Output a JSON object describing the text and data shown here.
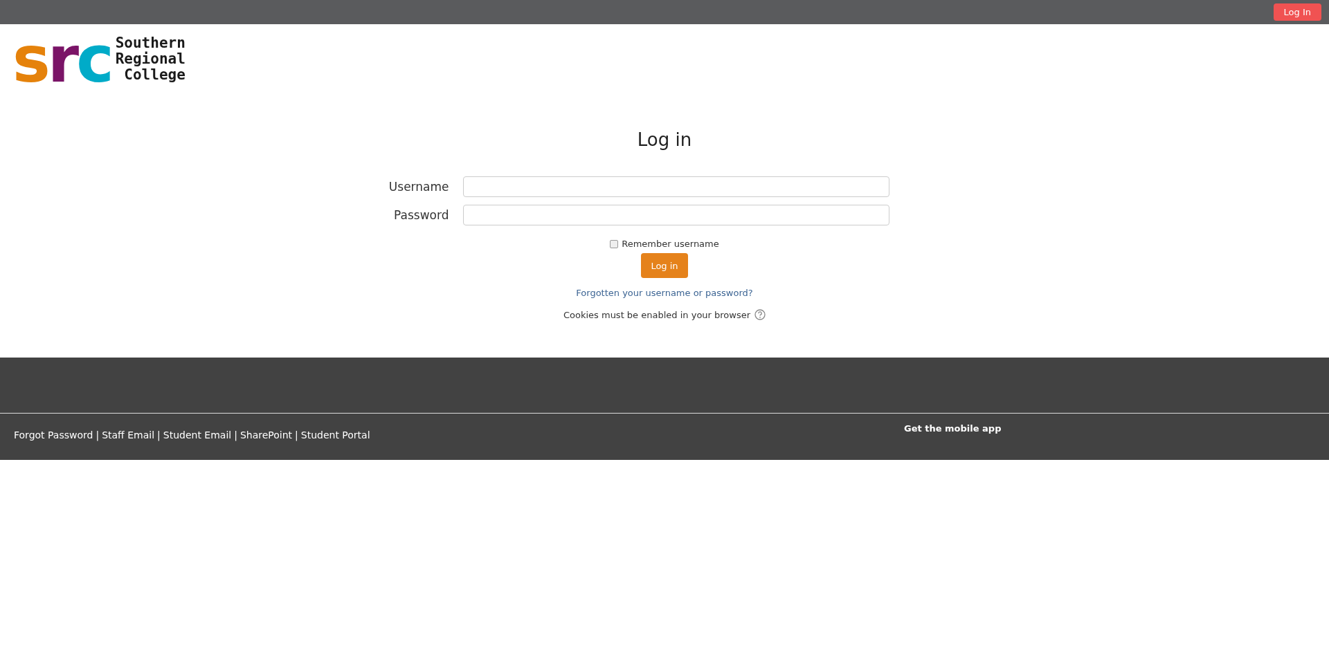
{
  "top_bar": {
    "login_button": "Log In"
  },
  "logo": {
    "letters": [
      {
        "text": "s",
        "color": "#e5820b"
      },
      {
        "text": "r",
        "color": "#7a1467"
      },
      {
        "text": "c",
        "color": "#00abc8"
      }
    ],
    "name_lines": [
      "Southern",
      "Regional",
      "College"
    ]
  },
  "login_form": {
    "title": "Log in",
    "fields": [
      {
        "label": "Username"
      },
      {
        "label": "Password"
      }
    ],
    "remember": {
      "label": "Remember username",
      "checked": false
    },
    "submit": "Log in",
    "forgot_link": "Forgotten your username or password?",
    "cookies_note": "Cookies must be enabled in your browser"
  },
  "footer": {
    "links": [
      "Forgot Password",
      "Staff Email",
      "Student Email",
      "SharePoint",
      "Student Portal"
    ],
    "separator": "|",
    "mobile_app": "Get the mobile app"
  }
}
